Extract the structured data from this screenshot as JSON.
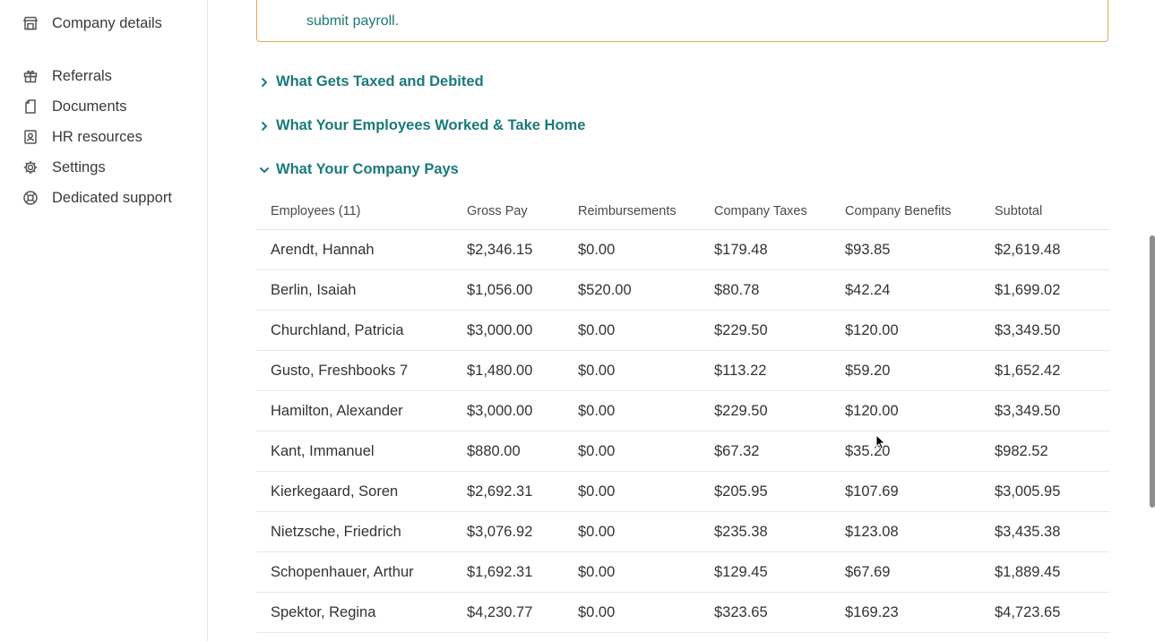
{
  "sidebar": {
    "items": [
      {
        "label": "Company details",
        "icon": "store-icon"
      },
      {
        "label": "Referrals",
        "icon": "gift-icon"
      },
      {
        "label": "Documents",
        "icon": "document-icon"
      },
      {
        "label": "HR resources",
        "icon": "person-badge-icon"
      },
      {
        "label": "Settings",
        "icon": "gear-icon"
      },
      {
        "label": "Dedicated support",
        "icon": "lifebuoy-icon"
      }
    ]
  },
  "notice": {
    "text": "submit payroll."
  },
  "sections": [
    {
      "label": "What Gets Taxed and Debited",
      "expanded": false
    },
    {
      "label": "What Your Employees Worked & Take Home",
      "expanded": false
    },
    {
      "label": "What Your Company Pays",
      "expanded": true
    }
  ],
  "table": {
    "headers": [
      "Employees (11)",
      "Gross Pay",
      "Reimbursements",
      "Company Taxes",
      "Company Benefits",
      "Subtotal"
    ],
    "rows": [
      [
        "Arendt, Hannah",
        "$2,346.15",
        "$0.00",
        "$179.48",
        "$93.85",
        "$2,619.48"
      ],
      [
        "Berlin, Isaiah",
        "$1,056.00",
        "$520.00",
        "$80.78",
        "$42.24",
        "$1,699.02"
      ],
      [
        "Churchland, Patricia",
        "$3,000.00",
        "$0.00",
        "$229.50",
        "$120.00",
        "$3,349.50"
      ],
      [
        "Gusto, Freshbooks 7",
        "$1,480.00",
        "$0.00",
        "$113.22",
        "$59.20",
        "$1,652.42"
      ],
      [
        "Hamilton, Alexander",
        "$3,000.00",
        "$0.00",
        "$229.50",
        "$120.00",
        "$3,349.50"
      ],
      [
        "Kant, Immanuel",
        "$880.00",
        "$0.00",
        "$67.32",
        "$35.20",
        "$982.52"
      ],
      [
        "Kierkegaard, Soren",
        "$2,692.31",
        "$0.00",
        "$205.95",
        "$107.69",
        "$3,005.95"
      ],
      [
        "Nietzsche, Friedrich",
        "$3,076.92",
        "$0.00",
        "$235.38",
        "$123.08",
        "$3,435.38"
      ],
      [
        "Schopenhauer, Arthur",
        "$1,692.31",
        "$0.00",
        "$129.45",
        "$67.69",
        "$1,889.45"
      ],
      [
        "Spektor, Regina",
        "$4,230.77",
        "$0.00",
        "$323.65",
        "$169.23",
        "$4,723.65"
      ]
    ]
  },
  "colors": {
    "accent": "#1b7a7a",
    "notice_border": "#e6a75c"
  }
}
